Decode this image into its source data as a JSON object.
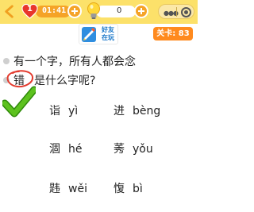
{
  "topbar": {
    "lives": "1",
    "timer": "01:41",
    "hints": "0"
  },
  "share": {
    "line1": "好友",
    "line2": "在玩"
  },
  "level": {
    "text": "关卡: 83"
  },
  "question": {
    "line1": "有一个字，所有人都会念",
    "char": "错",
    "line2": "是什么字呢?"
  },
  "answers": [
    {
      "char": "诣",
      "pinyin": "yì"
    },
    {
      "char": "进",
      "pinyin": "bèng"
    },
    {
      "char": "涸",
      "pinyin": "hé"
    },
    {
      "char": "莠",
      "pinyin": "yǒu"
    },
    {
      "char": "韪",
      "pinyin": "wěi"
    },
    {
      "char": "愎",
      "pinyin": "bì"
    }
  ],
  "colors": {
    "topbar": "#fce16a",
    "accent_orange": "#ff8a1e",
    "heart_red": "#e8362b",
    "check_green": "#5dc21e",
    "circle_red": "#e33b2e"
  }
}
